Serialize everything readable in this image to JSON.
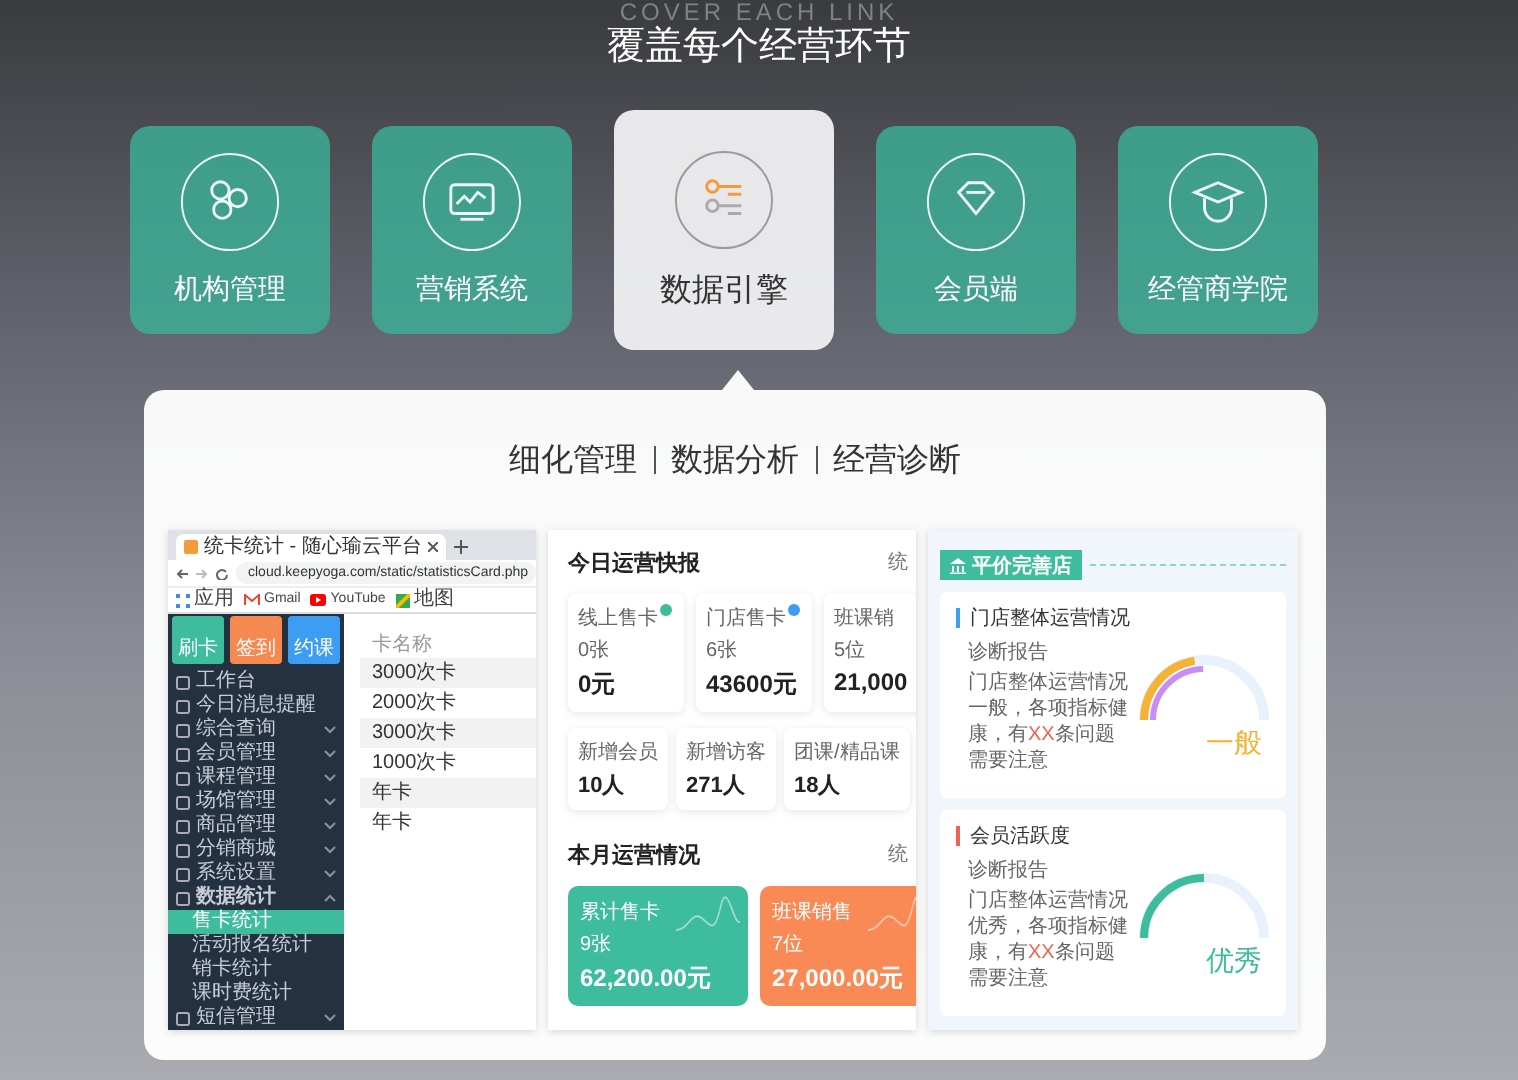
{
  "background_heading": "COVER EACH LINK",
  "title": "覆盖每个经营环节",
  "modules": [
    {
      "label": "机构管理",
      "kind": "circles",
      "selected": false
    },
    {
      "label": "营销系统",
      "kind": "monitor",
      "selected": false
    },
    {
      "label": "数据引擎",
      "kind": "list",
      "selected": true
    },
    {
      "label": "会员端",
      "kind": "diamond",
      "selected": false
    },
    {
      "label": "经管商学院",
      "kind": "cap",
      "selected": false
    }
  ],
  "features": [
    "细化管理",
    "数据分析",
    "经营诊断"
  ],
  "screens": {
    "browser": {
      "tab_title": "统卡统计 - 随心瑜云平台",
      "url": "cloud.keepyoga.com/static/statisticsCard.php",
      "bookmarks": [
        {
          "label": "应用",
          "kind": "apps"
        },
        {
          "label": "Gmail",
          "kind": "mail"
        },
        {
          "label": "YouTube",
          "kind": "video"
        },
        {
          "label": "地图",
          "kind": "map"
        }
      ],
      "quick_actions": [
        {
          "label": "刷卡",
          "color": "#3dbd9d"
        },
        {
          "label": "签到",
          "color": "#f5894f"
        },
        {
          "label": "约课",
          "color": "#3d9df2"
        }
      ],
      "menu": [
        {
          "label": "工作台",
          "kind": "link"
        },
        {
          "label": "今日消息提醒",
          "kind": "link"
        },
        {
          "label": "综合查询",
          "kind": "group",
          "expanded": false
        },
        {
          "label": "会员管理",
          "kind": "group",
          "expanded": false
        },
        {
          "label": "课程管理",
          "kind": "group",
          "expanded": false
        },
        {
          "label": "场馆管理",
          "kind": "group",
          "expanded": false
        },
        {
          "label": "商品管理",
          "kind": "group",
          "expanded": false
        },
        {
          "label": "分销商城",
          "kind": "group",
          "expanded": false
        },
        {
          "label": "系统设置",
          "kind": "group",
          "expanded": false
        },
        {
          "label": "数据统计",
          "kind": "group",
          "expanded": true,
          "children": [
            {
              "label": "售卡统计",
              "selected": true
            },
            {
              "label": "活动报名统计",
              "selected": false
            },
            {
              "label": "销卡统计",
              "selected": false
            },
            {
              "label": "课时费统计",
              "selected": false
            }
          ]
        },
        {
          "label": "短信管理",
          "kind": "group",
          "expanded": false
        }
      ],
      "table": {
        "column": "卡名称",
        "rows": [
          "3000次卡",
          "2000次卡",
          "3000次卡",
          "1000次卡",
          "年卡",
          "年卡"
        ]
      }
    },
    "dashboard": {
      "today_title": "今日运营快报",
      "today_link": "统",
      "sales": [
        {
          "label": "线上售卡",
          "count": "0张",
          "amount": "0元",
          "color": "#3dbd9d"
        },
        {
          "label": "门店售卡",
          "count": "6张",
          "amount": "43600元",
          "color": "#3d9df2"
        },
        {
          "label": "班课销",
          "count": "5位",
          "amount": "21,000"
        }
      ],
      "visitors": [
        {
          "label": "新增会员",
          "value": "10人"
        },
        {
          "label": "新增访客",
          "value": "271人"
        },
        {
          "label": "团课/精品课",
          "value": "18人"
        }
      ],
      "month_title": "本月运营情况",
      "month_link": "统",
      "month_cards": [
        {
          "label": "累计售卡",
          "count": "9张",
          "amount": "62,200.00元",
          "color": "#3dbd9d"
        },
        {
          "label": "班课销售",
          "count": "7位",
          "amount": "27,000.00元",
          "color": "#f98a55"
        }
      ]
    },
    "diagnosis": {
      "tag": "平价完善店",
      "cards": [
        {
          "title": "门店整体运营情况",
          "color": "#3d9df2",
          "heading": "诊断报告",
          "text_before": "门店整体运营情况一般，各项指标健康，有",
          "highlight": "XX",
          "text_after": "条问题需要注意",
          "gauge": {
            "kind": "double",
            "level": 0.45,
            "label": "一般",
            "color": "#f5b335"
          }
        },
        {
          "title": "会员活跃度",
          "color": "#f0614f",
          "heading": "诊断报告",
          "text_before": "门店整体运营情况优秀，各项指标健康，有",
          "highlight": "XX",
          "text_after": "条问题需要注意",
          "gauge": {
            "kind": "single",
            "level": 0.5,
            "label": "优秀",
            "color": "#3dbd9d"
          }
        }
      ]
    }
  }
}
